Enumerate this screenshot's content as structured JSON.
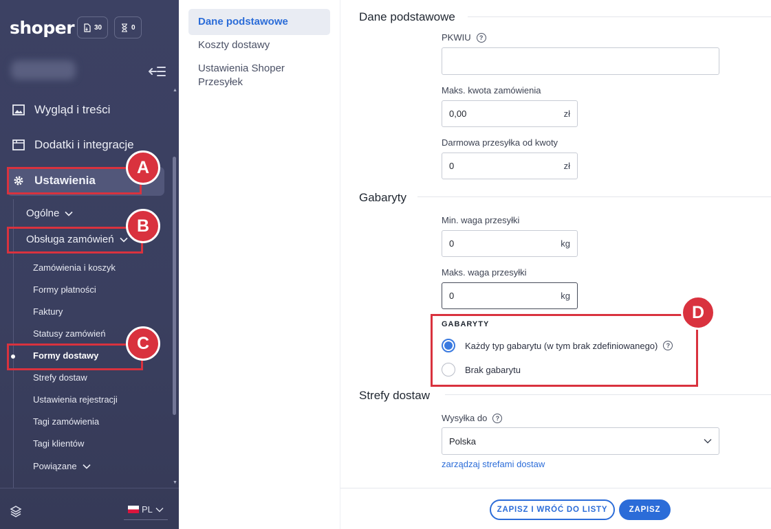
{
  "sidebar": {
    "logo": "shoper",
    "chips": [
      {
        "icon": "document-icon",
        "count": "30"
      },
      {
        "icon": "hourglass-icon",
        "count": "0"
      }
    ],
    "nav": [
      {
        "label": "Wygląd i treści",
        "icon": "image-icon"
      },
      {
        "label": "Dodatki i integracje",
        "icon": "window-icon"
      },
      {
        "label": "Ustawienia",
        "icon": "gear-icon"
      }
    ],
    "settings_sub": [
      {
        "label": "Ogólne"
      },
      {
        "label": "Obsługa zamówień"
      }
    ],
    "orders_sub": [
      "Zamówienia i koszyk",
      "Formy płatności",
      "Faktury",
      "Statusy zamówień",
      "Formy dostawy",
      "Strefy dostaw",
      "Ustawienia rejestracji",
      "Tagi zamówienia",
      "Tagi klientów",
      "Powiązane"
    ],
    "language": "PL"
  },
  "annotations": [
    "A",
    "B",
    "C",
    "D"
  ],
  "subnav": [
    {
      "label": "Dane podstawowe",
      "active": true
    },
    {
      "label": "Koszty dostawy",
      "active": false
    },
    {
      "label": "Ustawienia Shoper Przesyłek",
      "active": false
    }
  ],
  "sections": {
    "basic": {
      "title": "Dane podstawowe",
      "pkwiu_label": "PKWIU",
      "pkwiu_value": "",
      "max_order_label": "Maks. kwota zamówienia",
      "max_order_value": "0,00",
      "max_order_unit": "zł",
      "free_shipping_label": "Darmowa przesyłka od kwoty",
      "free_shipping_value": "0",
      "free_shipping_unit": "zł"
    },
    "dimensions": {
      "title": "Gabaryty",
      "min_weight_label": "Min. waga przesyłki",
      "min_weight_value": "0",
      "min_weight_unit": "kg",
      "max_weight_label": "Maks. waga przesyłki",
      "max_weight_value": "0",
      "max_weight_unit": "kg",
      "group_label": "GABARYTY",
      "options": [
        {
          "label": "Każdy typ gabarytu (w tym brak zdefiniowanego)",
          "selected": true
        },
        {
          "label": "Brak gabarytu",
          "selected": false
        }
      ]
    },
    "zones": {
      "title": "Strefy dostaw",
      "ship_to_label": "Wysyłka do",
      "ship_to_value": "Polska",
      "manage_link": "zarządzaj strefami dostaw"
    }
  },
  "footer": {
    "save_back_label": "ZAPISZ I WRÓĆ DO LISTY",
    "save_label": "ZAPISZ"
  },
  "colors": {
    "sidebar": "#3c4163",
    "accent": "#2b6cd8",
    "annotation": "#d9323e"
  }
}
